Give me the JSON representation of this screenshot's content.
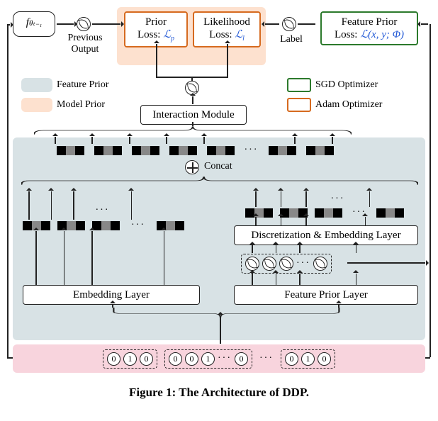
{
  "node_f_theta": "f",
  "node_f_theta_sub": "θₜ₋₁",
  "labels": {
    "previous_output": "Previous\nOutput",
    "label": "Label",
    "concat": "Concat",
    "ellipsis": "···"
  },
  "losses": {
    "prior_title": "Prior",
    "prior_line2_a": "Loss: ",
    "prior_sym": "ℒ",
    "prior_sub": "p",
    "lik_title": "Likelihood",
    "lik_line2_a": "Loss: ",
    "lik_sym": "ℒ",
    "lik_sub": "l",
    "fp_title": "Feature Prior",
    "fp_line2_a": "Loss: ",
    "fp_sym": "ℒ(x, y; Φ)"
  },
  "legend": {
    "feature_prior": "Feature Prior",
    "model_prior": "Model Prior",
    "sgd": "SGD Optimizer",
    "adam": "Adam Optimizer"
  },
  "modules": {
    "interaction": "Interaction Module",
    "disc_emb": "Discretization & Embedding Layer",
    "embedding": "Embedding Layer",
    "feature_prior": "Feature Prior Layer"
  },
  "input_vals": {
    "zero": "0",
    "one": "1"
  },
  "caption": "Figure 1: The Architecture of DDP."
}
